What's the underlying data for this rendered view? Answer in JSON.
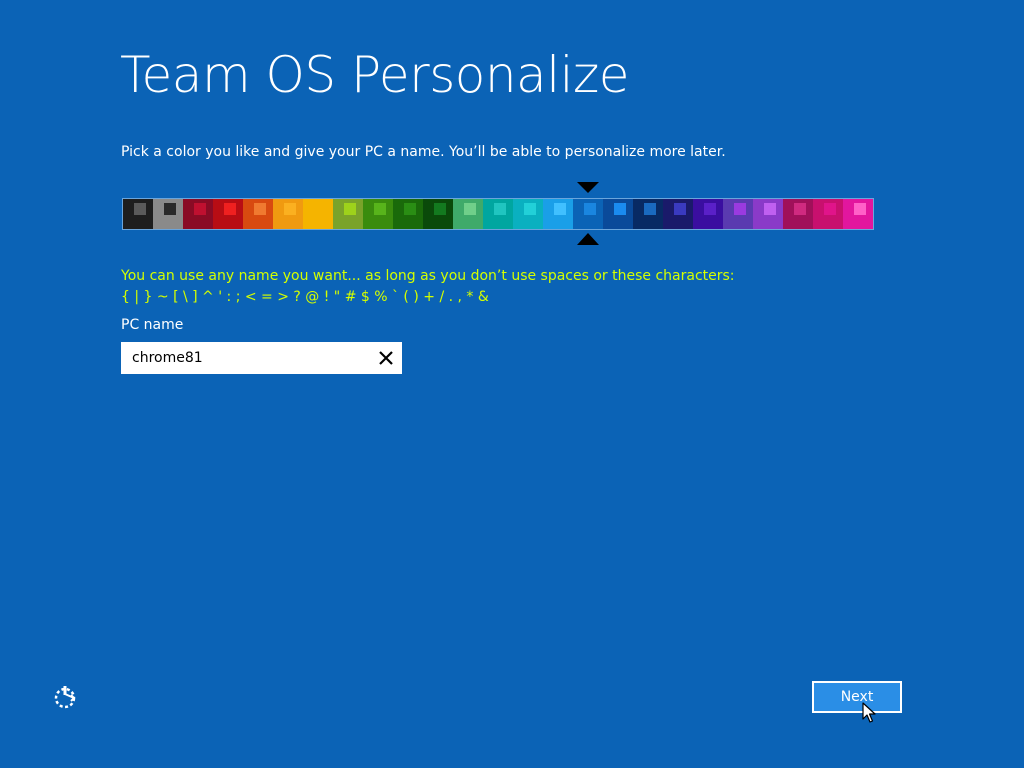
{
  "page": {
    "title": "Team OS Personalize",
    "subtitle": "Pick a color you like and give your PC a name. You’ll be able to personalize more later."
  },
  "colors": {
    "background": "#0b63b6",
    "hint_text": "#d4ff00",
    "selected_swatch_index": 15,
    "swatches": [
      {
        "bg": "#1e1e1e",
        "accent": "#5a5a5a"
      },
      {
        "bg": "#8a8a8a",
        "accent": "#2a2a2a"
      },
      {
        "bg": "#8a0b25",
        "accent": "#c01030"
      },
      {
        "bg": "#b80d14",
        "accent": "#f02020"
      },
      {
        "bg": "#d84a10",
        "accent": "#f07a30"
      },
      {
        "bg": "#f09a10",
        "accent": "#fbb020"
      },
      {
        "bg": "#f5b400",
        "accent": "#f5b400"
      },
      {
        "bg": "#7aa32a",
        "accent": "#9ed21b"
      },
      {
        "bg": "#3a8c0e",
        "accent": "#58b41b"
      },
      {
        "bg": "#1a6a0a",
        "accent": "#2a8e14"
      },
      {
        "bg": "#0a4a0a",
        "accent": "#137a1f"
      },
      {
        "bg": "#3faa6a",
        "accent": "#70cf8a"
      },
      {
        "bg": "#00a6a0",
        "accent": "#20c5c0"
      },
      {
        "bg": "#0ab0c0",
        "accent": "#22d0d8"
      },
      {
        "bg": "#1a9fe8",
        "accent": "#40c0ff"
      },
      {
        "bg": "#0b63b6",
        "accent": "#1a86e0"
      },
      {
        "bg": "#0a4a9a",
        "accent": "#1a8bf0"
      },
      {
        "bg": "#082a64",
        "accent": "#1a6ac0"
      },
      {
        "bg": "#1a1a6a",
        "accent": "#3a3ac0"
      },
      {
        "bg": "#3a0ea0",
        "accent": "#5a20c8"
      },
      {
        "bg": "#5a3ab0",
        "accent": "#9a3ae0"
      },
      {
        "bg": "#8a3ac8",
        "accent": "#c060f0"
      },
      {
        "bg": "#a0105a",
        "accent": "#d02a80"
      },
      {
        "bg": "#c8106e",
        "accent": "#e0148a"
      },
      {
        "bg": "#e2169e",
        "accent": "#ff60c8"
      }
    ]
  },
  "hint": {
    "line1": "You can use any name you want... as long as you don’t use spaces or these characters:",
    "line2": "{ | } ~ [ \\ ] ^ ' : ; < = > ? @ ! \" # $ % ` ( ) + / . , * &"
  },
  "pc_name": {
    "label": "PC name",
    "value": "chrome81"
  },
  "footer": {
    "next_label": "Next",
    "ease_of_access_icon": "ease-of-access-icon"
  }
}
